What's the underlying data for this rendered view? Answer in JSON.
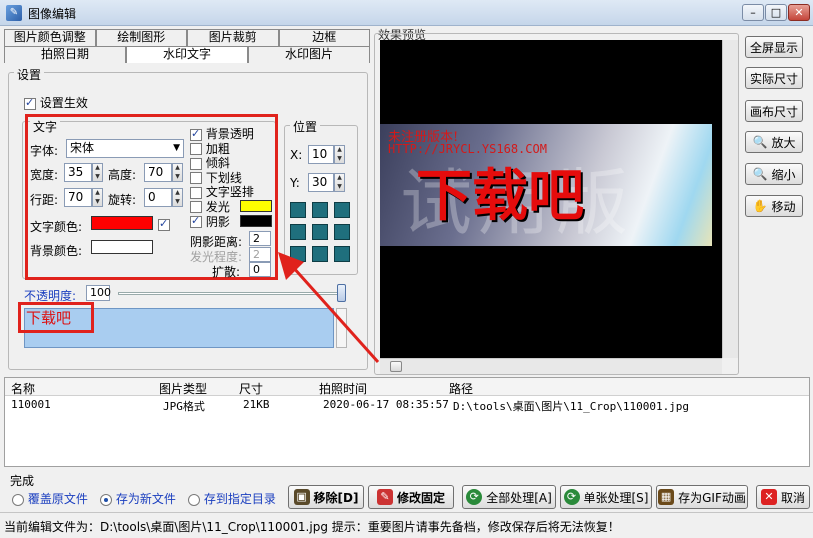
{
  "window": {
    "title": "图像编辑",
    "min": "–",
    "max": "□",
    "close": "✕"
  },
  "tabs_row1": [
    "图片颜色调整",
    "绘制图形",
    "图片裁剪",
    "边框"
  ],
  "tabs_row2": [
    "拍照日期",
    "水印文字",
    "水印图片"
  ],
  "settings": {
    "legend": "设置",
    "enable_label": "设置生效"
  },
  "text_group": {
    "legend": "文字",
    "font_label": "字体:",
    "font_value": "宋体",
    "width_label": "宽度:",
    "width_value": "35",
    "height_label": "高度:",
    "height_value": "70",
    "spacing_label": "行距:",
    "spacing_value": "70",
    "rotate_label": "旋转:",
    "rotate_value": "0",
    "text_color_label": "文字颜色:",
    "bg_color_label": "背景颜色:",
    "colors": {
      "text": "#ff0000",
      "bg": "#ffffff",
      "glow": "#ffff00",
      "shadow": "#000000"
    },
    "opts": {
      "bg_transparent": "背景透明",
      "bold": "加粗",
      "italic": "倾斜",
      "underline": "下划线",
      "vertical": "文字竖排",
      "glow": "发光",
      "shadow": "阴影"
    },
    "shadow_dist_label": "阴影距离:",
    "shadow_dist_value": "2",
    "glow_level_label": "发光程度:",
    "glow_level_value": "2",
    "spread_label": "扩散:",
    "spread_value": "0"
  },
  "position": {
    "legend": "位置",
    "x_label": "X:",
    "x_value": "10",
    "y_label": "Y:",
    "y_value": "30"
  },
  "opacity": {
    "label": "不透明度:",
    "value": "100"
  },
  "watermark_text": "下载吧",
  "preview": {
    "label": "效果预览",
    "unregistered": "未注册版本!",
    "url": "HTTP://JRYCL.YS168.COM",
    "big_text": "下载吧",
    "bg_text": "试用版"
  },
  "right_buttons": {
    "fullscreen": "全屏显示",
    "actual": "实际尺寸",
    "canvas": "画布尺寸",
    "zoom_in": "放大",
    "zoom_out": "缩小",
    "move": "移动"
  },
  "table": {
    "headers": [
      "名称",
      "图片类型",
      "尺寸",
      "拍照时间",
      "路径"
    ],
    "row": [
      "110001",
      "JPG格式",
      "21KB",
      "2020-06-17 08:35:57",
      "D:\\tools\\桌面\\图片\\11_Crop\\110001.jpg"
    ]
  },
  "bottom": {
    "done": "完成",
    "overwrite": "覆盖原文件",
    "save_new": "存为新文件",
    "save_dir": "存到指定目录",
    "remove": "移除[D]",
    "fix": "修改固定",
    "batch": "全部处理[A]",
    "single": "单张处理[S]",
    "gif": "存为GIF动画",
    "cancel": "取消"
  },
  "status": {
    "text": "当前编辑文件为：D:\\tools\\桌面\\图片\\11_Crop\\110001.jpg   提示：重要图片请事先备档，修改保存后将无法恢复！"
  }
}
